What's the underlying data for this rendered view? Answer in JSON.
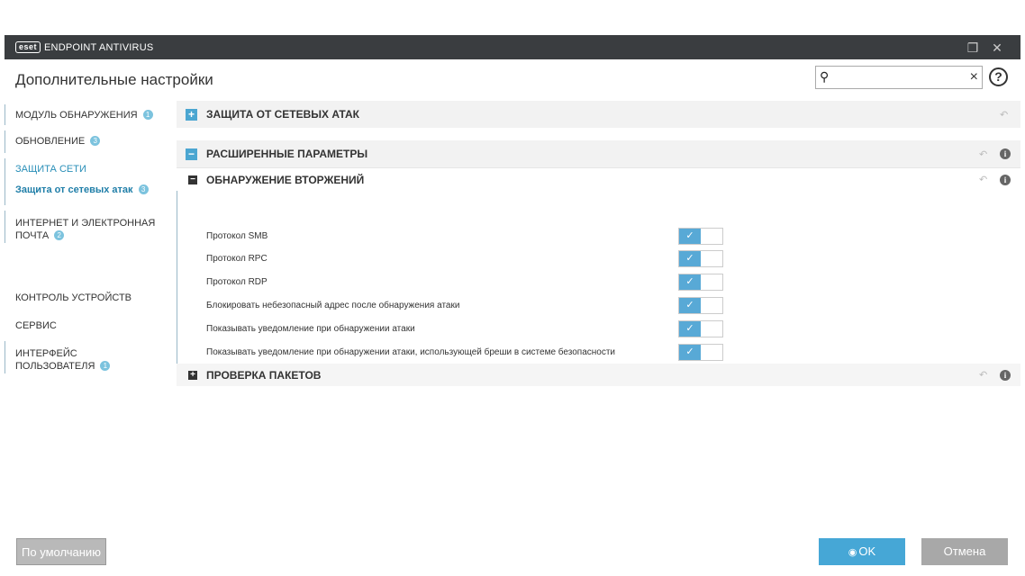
{
  "titlebar": {
    "logo": "eset",
    "app_name": "ENDPOINT ANTIVIRUS",
    "restore": "❐",
    "close": "✕"
  },
  "header": {
    "title": "Дополнительные настройки",
    "search_value": "",
    "search_placeholder": "",
    "help": "?"
  },
  "sidebar": {
    "items": [
      {
        "label": "МОДУЛЬ ОБНАРУЖЕНИЯ",
        "badge": "1"
      },
      {
        "label": "ОБНОВЛЕНИЕ",
        "badge": "3"
      },
      {
        "label": "ЗАЩИТА СЕТИ",
        "badge": ""
      },
      {
        "label": "Защита от сетевых атак",
        "badge": "3"
      },
      {
        "label_line1": "ИНТЕРНЕТ И ЭЛЕКТРОННАЯ",
        "label_line2": "ПОЧТА",
        "badge": "2"
      },
      {
        "label": "КОНТРОЛЬ УСТРОЙСТВ",
        "badge": ""
      },
      {
        "label": "СЕРВИС",
        "badge": ""
      },
      {
        "label_line1": "ИНТЕРФЕЙС",
        "label_line2": "ПОЛЬЗОВАТЕЛЯ",
        "badge": "1"
      }
    ]
  },
  "sections": {
    "network_attack": "ЗАЩИТА ОТ СЕТЕВЫХ АТАК",
    "advanced": "РАСШИРЕННЫЕ ПАРАМЕТРЫ",
    "intrusion": "ОБНАРУЖЕНИЕ ВТОРЖЕНИЙ",
    "packet": "ПРОВЕРКА ПАКЕТОВ"
  },
  "settings": [
    {
      "label": "Протокол SMB",
      "enabled": true
    },
    {
      "label": "Протокол RPC",
      "enabled": true
    },
    {
      "label": "Протокол RDP",
      "enabled": true
    },
    {
      "label": "Блокировать небезопасный адрес после обнаружения атаки",
      "enabled": true
    },
    {
      "label": "Показывать уведомление при обнаружении атаки",
      "enabled": true
    },
    {
      "label": "Показывать уведомление при обнаружении атаки, использующей бреши в системе безопасности",
      "enabled": true
    }
  ],
  "footer": {
    "default_label": "По умолчанию",
    "ok_label": "OK",
    "cancel_label": "Отмена"
  },
  "colors": {
    "accent": "#46a7d6",
    "titlebar": "#3a3d40",
    "toggle_on": "#58a9d6"
  }
}
